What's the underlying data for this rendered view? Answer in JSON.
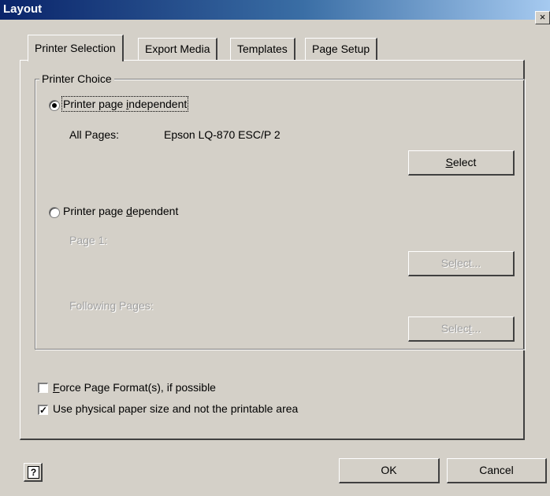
{
  "window": {
    "title": "Layout",
    "close_glyph": "×"
  },
  "tabs": [
    {
      "label": "Printer Selection",
      "active": true
    },
    {
      "label": "Export Media",
      "active": false
    },
    {
      "label": "Templates",
      "active": false
    },
    {
      "label": "Page Setup",
      "active": false
    }
  ],
  "printer_choice": {
    "legend": "Printer Choice",
    "independent": {
      "label_pre": "Printer page ",
      "label_u": "i",
      "label_post": "ndependent",
      "selected": true,
      "all_pages_label": "All Pages:",
      "all_pages_value": "Epson LQ-870 ESC/P 2",
      "select_pre": "",
      "select_u": "S",
      "select_post": "elect"
    },
    "dependent": {
      "label_pre": "Printer page ",
      "label_u": "d",
      "label_post": "ependent",
      "selected": false,
      "page1_label": "Page 1:",
      "page1_select_pre": "Se",
      "page1_select_u": "l",
      "page1_select_post": "ect...",
      "following_label": "Following Pages:",
      "following_select_pre": "Selec",
      "following_select_u": "t",
      "following_select_post": "..."
    }
  },
  "options": {
    "force_pre": "",
    "force_u": "F",
    "force_post": "orce Page Format(s), if possible",
    "force_checked": false,
    "physical_label": "Use physical paper size and not the printable area",
    "physical_checked": true,
    "check_glyph": "✓"
  },
  "footer": {
    "help_glyph": "?",
    "ok_label": "OK",
    "cancel_label": "Cancel"
  }
}
